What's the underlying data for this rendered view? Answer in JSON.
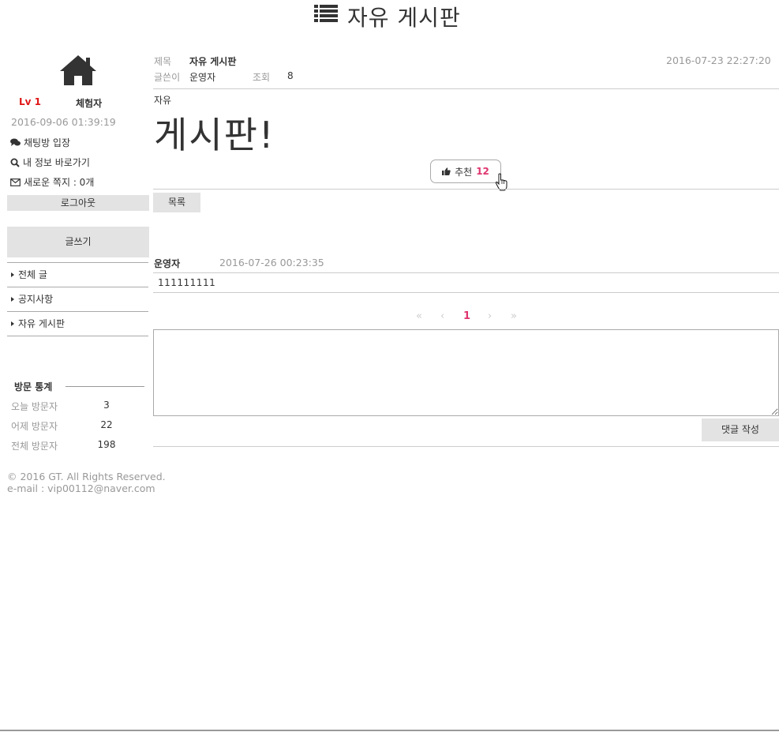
{
  "header": {
    "title": "자유 게시판",
    "icon": "list-icon"
  },
  "sidebar": {
    "home_icon": "home-icon",
    "level": "Lv 1",
    "user_level_name": "체험자",
    "last_login": "2016-09-06 01:39:19",
    "links": [
      {
        "icon": "chat-icon",
        "label": "채팅방 입장"
      },
      {
        "icon": "search-icon",
        "label": "내 정보 바로가기"
      },
      {
        "icon": "envelope-icon",
        "label": "새로운 쪽지 : 0개"
      }
    ],
    "logout_label": "로그아웃",
    "write_label": "글쓰기",
    "menu": [
      {
        "label": "전체 글"
      },
      {
        "label": "공지사항"
      },
      {
        "label": "자유 게시판"
      }
    ],
    "stats": {
      "title": "방문 통계",
      "rows": [
        {
          "label": "오늘 방문자",
          "value": "3"
        },
        {
          "label": "어제 방문자",
          "value": "22"
        },
        {
          "label": "전체 방문자",
          "value": "198"
        }
      ]
    },
    "copyright": "© 2016 GT. All Rights Reserved.",
    "email": "e-mail : vip00112@naver.com"
  },
  "post": {
    "title_label": "제목",
    "title": "자유 게시판",
    "author_label": "글쓴이",
    "author": "운영자",
    "views_label": "조회",
    "views": "8",
    "date": "2016-07-23 22:27:20",
    "body_small": "자유",
    "body_large": "게시판!",
    "like_label": "추천",
    "like_count": "12",
    "list_button": "목록"
  },
  "comments": [
    {
      "author": "운영자",
      "date": "2016-07-26 00:23:35",
      "text": "111111111"
    }
  ],
  "pagination": {
    "first": "«",
    "prev": "‹",
    "current": "1",
    "next": "›",
    "last": "»"
  },
  "comment_form": {
    "value": "",
    "submit_label": "댓글 작성"
  },
  "colors": {
    "accent": "#e0346f",
    "level_red": "#e01515",
    "button_gray": "#e3e3e3"
  }
}
